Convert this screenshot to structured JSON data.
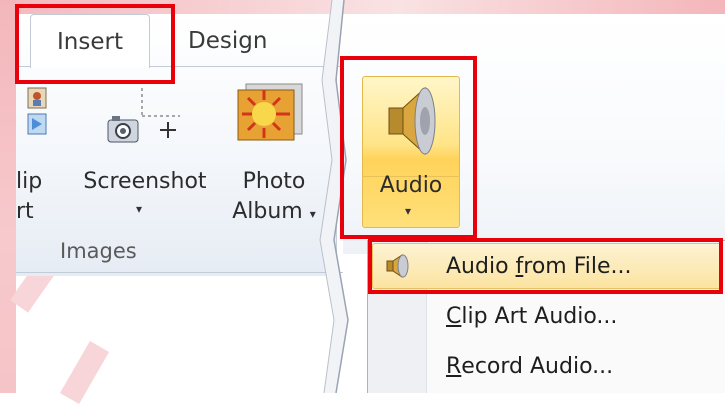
{
  "ribbon": {
    "tabs": {
      "insert": "Insert",
      "design": "Design"
    },
    "images_group": {
      "label": "Images",
      "clip_art_partial_top": "lip",
      "clip_art_partial_bottom": "rt",
      "screenshot": "Screenshot",
      "photo_album_line1": "Photo",
      "photo_album_line2": "Album",
      "dropdown_arrow": "▾"
    },
    "audio_button": {
      "label": "Audio",
      "arrow": "▾"
    }
  },
  "audio_menu": {
    "items": [
      {
        "pre": "Audio ",
        "accel": "f",
        "post": "rom File..."
      },
      {
        "pre": "",
        "accel": "C",
        "post": "lip Art Audio..."
      },
      {
        "pre": "",
        "accel": "R",
        "post": "ecord Audio..."
      }
    ]
  },
  "colors": {
    "highlight_box": "#e8000b",
    "audio_button_bg": "#ffe488",
    "background_tint": "#f4b9bd"
  },
  "icons": {
    "clip_art": "clip-art-icon",
    "screenshot": "camera-icon",
    "photo_album": "photo-album-icon",
    "audio": "speaker-icon",
    "audio_file": "speaker-small-icon"
  }
}
